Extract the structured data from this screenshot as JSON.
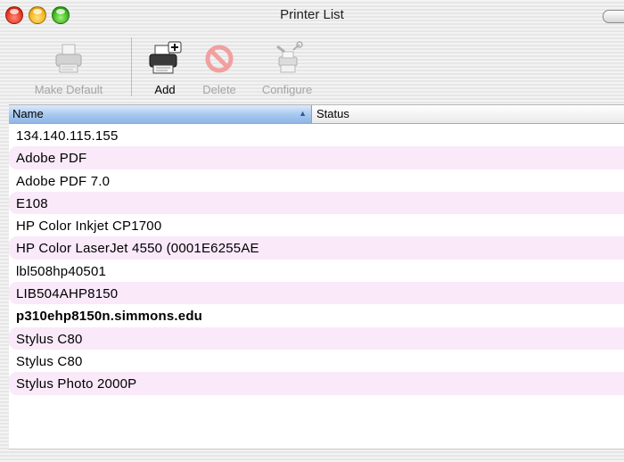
{
  "window": {
    "title": "Printer List"
  },
  "toolbar": {
    "make_default": {
      "label": "Make Default",
      "icon": "printer-icon",
      "enabled": false
    },
    "add": {
      "label": "Add",
      "icon": "add-printer-icon",
      "enabled": true
    },
    "delete": {
      "label": "Delete",
      "icon": "delete-icon",
      "enabled": false
    },
    "configure": {
      "label": "Configure",
      "icon": "configure-icon",
      "enabled": false
    }
  },
  "table": {
    "columns": [
      {
        "label": "Name",
        "sorted": "ascending"
      },
      {
        "label": "Status"
      }
    ],
    "rows": [
      {
        "name": "134.140.115.155",
        "status": "",
        "bold": false
      },
      {
        "name": "Adobe PDF",
        "status": "",
        "bold": false
      },
      {
        "name": "Adobe PDF 7.0",
        "status": "",
        "bold": false
      },
      {
        "name": "E108",
        "status": "",
        "bold": false
      },
      {
        "name": "HP Color Inkjet CP1700",
        "status": "",
        "bold": false
      },
      {
        "name": "HP Color LaserJet 4550 (0001E6255AE",
        "status": "",
        "bold": false
      },
      {
        "name": "lbl508hp40501",
        "status": "",
        "bold": false
      },
      {
        "name": "LIB504AHP8150",
        "status": "",
        "bold": false
      },
      {
        "name": "p310ehp8150n.simmons.edu",
        "status": "",
        "bold": true
      },
      {
        "name": "Stylus C80",
        "status": "",
        "bold": false
      },
      {
        "name": "Stylus C80",
        "status": "",
        "bold": false
      },
      {
        "name": "Stylus Photo 2000P",
        "status": "",
        "bold": false
      }
    ]
  },
  "colors": {
    "header_selected": "#a5c7ef",
    "row_stripe": "#f9e9f9",
    "disabled_text": "#a5a5a5"
  }
}
